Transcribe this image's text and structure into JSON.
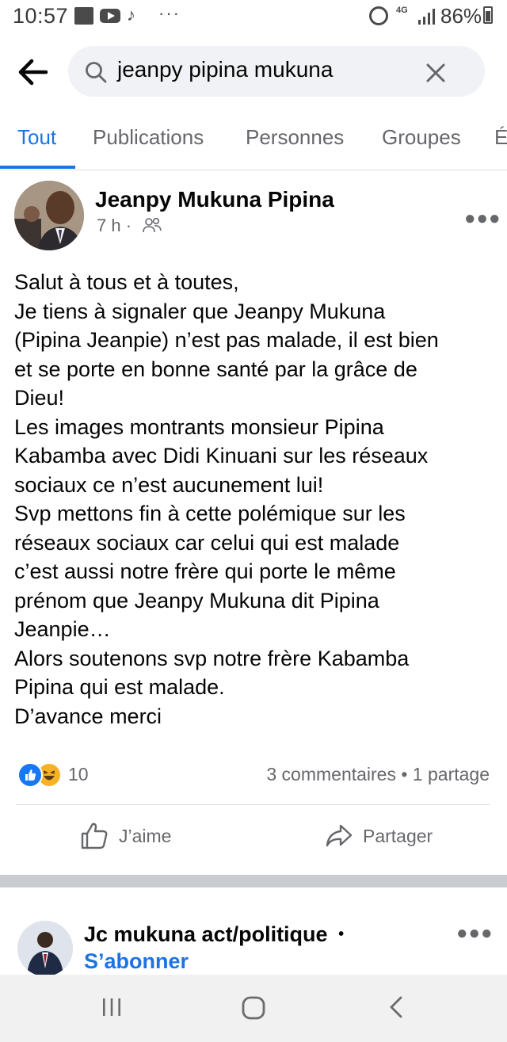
{
  "status_bar": {
    "time": "10:57",
    "network": "4G",
    "battery": "86%"
  },
  "search": {
    "query": "jeanpy pipina mukuna"
  },
  "tabs": [
    {
      "label": "Tout",
      "active": true
    },
    {
      "label": "Publications",
      "active": false
    },
    {
      "label": "Personnes",
      "active": false
    },
    {
      "label": "Groupes",
      "active": false
    },
    {
      "label": "É",
      "active": false
    }
  ],
  "post1": {
    "author": "Jeanpy Mukuna Pipina",
    "time": "7 h ·",
    "lines": [
      "Salut à tous et à toutes,",
      "Je tiens à signaler que Jeanpy Mukuna",
      "(Pipina Jeanpie) n’est pas malade, il est bien",
      "et se porte en bonne santé par la grâce de",
      "Dieu!",
      "Les images montrants monsieur Pipina",
      "Kabamba avec Didi Kinuani sur les réseaux",
      "sociaux ce n’est aucunement lui!",
      "Svp mettons fin à cette polémique sur les",
      "réseaux sociaux car celui qui est malade",
      "c’est aussi notre frère qui porte le même",
      "prénom que Jeanpy Mukuna dit Pipina",
      "Jeanpie…",
      "Alors soutenons svp notre frère Kabamba",
      "Pipina qui est malade.",
      "D’avance merci"
    ],
    "reaction_count": "10",
    "stats": "3 commentaires • 1 partage",
    "like_label": "J’aime",
    "share_label": "Partager"
  },
  "post2": {
    "author": "Jc mukuna act/politique",
    "separator": "•",
    "subscribe": "S’abonner"
  },
  "colors": {
    "accent": "#1b74e4",
    "muted": "#65676b"
  }
}
